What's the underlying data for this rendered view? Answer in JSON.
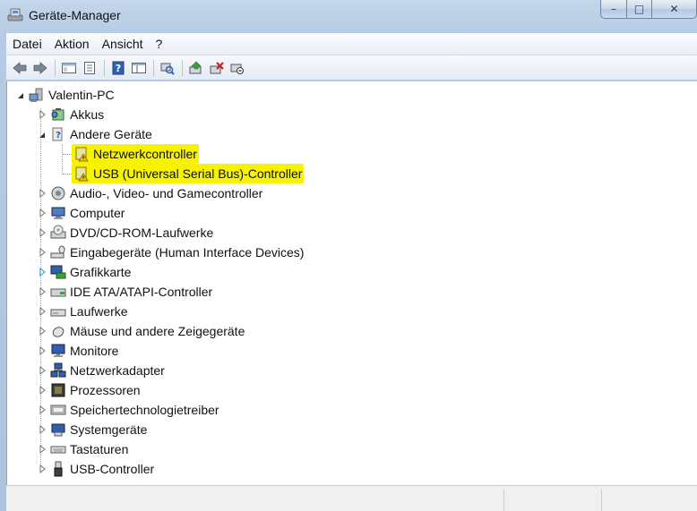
{
  "window": {
    "title": "Geräte-Manager"
  },
  "caption": {
    "minimize": "–",
    "maximize": "□",
    "close": "✕"
  },
  "menu": [
    "Datei",
    "Aktion",
    "Ansicht",
    "?"
  ],
  "toolbar_icons": [
    "back-arrow-icon",
    "forward-arrow-icon",
    "console-tree-icon",
    "properties-icon",
    "help-icon",
    "view-icon",
    "scan-hardware-icon",
    "update-driver-icon",
    "uninstall-icon",
    "disable-device-icon"
  ],
  "tree": {
    "root": "Valentin-PC",
    "items": [
      {
        "label": "Akkus",
        "expander": "collapsed",
        "icon": "battery-icon"
      },
      {
        "label": "Andere Geräte",
        "expander": "expanded",
        "icon": "unknown-device-icon"
      },
      {
        "label": "Netzwerkcontroller",
        "expander": "none",
        "icon": "warning-device-icon",
        "highlight": true
      },
      {
        "label": "USB (Universal Serial Bus)-Controller",
        "expander": "none",
        "icon": "warning-device-icon",
        "highlight": true
      },
      {
        "label": "Audio-, Video- und Gamecontroller",
        "expander": "collapsed",
        "icon": "audio-icon"
      },
      {
        "label": "Computer",
        "expander": "collapsed",
        "icon": "computer-icon"
      },
      {
        "label": "DVD/CD-ROM-Laufwerke",
        "expander": "collapsed",
        "icon": "dvd-drive-icon"
      },
      {
        "label": "Eingabegeräte (Human Interface Devices)",
        "expander": "collapsed",
        "icon": "hid-icon"
      },
      {
        "label": "Grafikkarte",
        "expander": "collapsed-hover",
        "icon": "display-adapter-icon"
      },
      {
        "label": "IDE ATA/ATAPI-Controller",
        "expander": "collapsed",
        "icon": "ide-controller-icon"
      },
      {
        "label": "Laufwerke",
        "expander": "collapsed",
        "icon": "disk-drive-icon"
      },
      {
        "label": "Mäuse und andere Zeigegeräte",
        "expander": "collapsed",
        "icon": "mouse-icon"
      },
      {
        "label": "Monitore",
        "expander": "collapsed",
        "icon": "monitor-icon"
      },
      {
        "label": "Netzwerkadapter",
        "expander": "collapsed",
        "icon": "network-adapter-icon"
      },
      {
        "label": "Prozessoren",
        "expander": "collapsed",
        "icon": "processor-icon"
      },
      {
        "label": "Speichertechnologietreiber",
        "expander": "collapsed",
        "icon": "storage-icon"
      },
      {
        "label": "Systemgeräte",
        "expander": "collapsed",
        "icon": "system-device-icon"
      },
      {
        "label": "Tastaturen",
        "expander": "collapsed",
        "icon": "keyboard-icon"
      },
      {
        "label": "USB-Controller",
        "expander": "collapsed",
        "icon": "usb-icon"
      }
    ]
  },
  "colors": {
    "highlight": "#f7f200",
    "accent": "#1e6fd0"
  }
}
